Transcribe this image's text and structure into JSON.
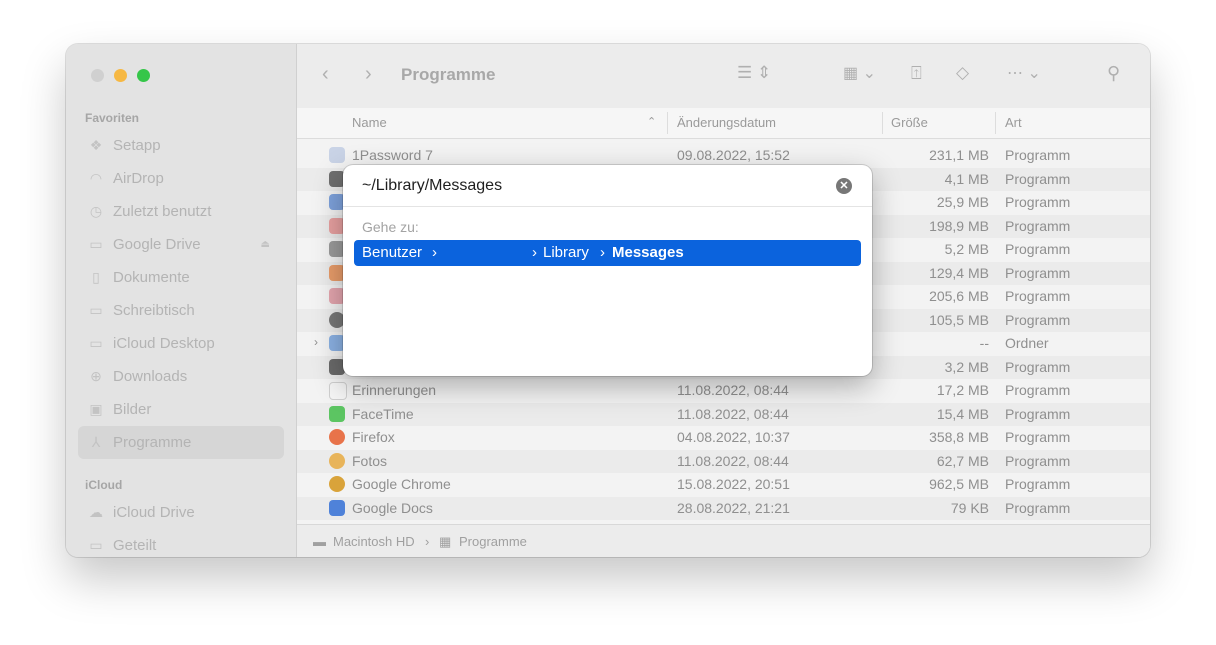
{
  "colors": {
    "accent": "#0b63dd",
    "minimize": "#f6b843",
    "maximize": "#35c649"
  },
  "sidebar": {
    "favorites_label": "Favoriten",
    "items": [
      {
        "label": "Setapp",
        "icon": "setapp-icon"
      },
      {
        "label": "AirDrop",
        "icon": "airdrop-icon"
      },
      {
        "label": "Zuletzt benutzt",
        "icon": "clock-icon"
      },
      {
        "label": "Google Drive",
        "icon": "drive-folder-icon"
      },
      {
        "label": "Dokumente",
        "icon": "document-icon"
      },
      {
        "label": "Schreibtisch",
        "icon": "desktop-icon"
      },
      {
        "label": "iCloud Desktop",
        "icon": "folder-icon"
      },
      {
        "label": "Downloads",
        "icon": "download-icon"
      },
      {
        "label": "Bilder",
        "icon": "photo-icon"
      },
      {
        "label": "Programme",
        "icon": "applications-icon",
        "active": true
      }
    ],
    "icloud_label": "iCloud",
    "icloud_items": [
      {
        "label": "iCloud Drive",
        "icon": "cloud-icon"
      },
      {
        "label": "Geteilt",
        "icon": "shared-folder-icon"
      }
    ]
  },
  "toolbar": {
    "title": "Programme"
  },
  "columns": {
    "name": "Name",
    "date": "Änderungsdatum",
    "size": "Größe",
    "kind": "Art"
  },
  "files": [
    {
      "name": "1Password 7",
      "date": "09.08.2022, 15:52",
      "size": "231,1 MB",
      "kind": "Programm"
    },
    {
      "name": "",
      "date": "",
      "size": "4,1 MB",
      "kind": "Programm"
    },
    {
      "name": "",
      "date": "",
      "size": "25,9 MB",
      "kind": "Programm"
    },
    {
      "name": "",
      "date": "",
      "size": "198,9 MB",
      "kind": "Programm"
    },
    {
      "name": "",
      "date": "",
      "size": "5,2 MB",
      "kind": "Programm"
    },
    {
      "name": "",
      "date": "",
      "size": "129,4 MB",
      "kind": "Programm"
    },
    {
      "name": "",
      "date": "",
      "size": "205,6 MB",
      "kind": "Programm"
    },
    {
      "name": "",
      "date": "",
      "size": "105,5 MB",
      "kind": "Programm"
    },
    {
      "name": "",
      "date": "",
      "size": "--",
      "kind": "Ordner"
    },
    {
      "name": "",
      "date": "",
      "size": "3,2 MB",
      "kind": "Programm"
    },
    {
      "name": "Erinnerungen",
      "date": "11.08.2022, 08:44",
      "size": "17,2 MB",
      "kind": "Programm"
    },
    {
      "name": "FaceTime",
      "date": "11.08.2022, 08:44",
      "size": "15,4 MB",
      "kind": "Programm"
    },
    {
      "name": "Firefox",
      "date": "04.08.2022, 10:37",
      "size": "358,8 MB",
      "kind": "Programm"
    },
    {
      "name": "Fotos",
      "date": "11.08.2022, 08:44",
      "size": "62,7 MB",
      "kind": "Programm"
    },
    {
      "name": "Google Chrome",
      "date": "15.08.2022, 20:51",
      "size": "962,5 MB",
      "kind": "Programm"
    },
    {
      "name": "Google Docs",
      "date": "28.08.2022, 21:21",
      "size": "79 KB",
      "kind": "Programm"
    }
  ],
  "pathbar": {
    "disk": "Macintosh HD",
    "sep": "›",
    "folder": "Programme"
  },
  "dialog": {
    "input_value": "~/Library/Messages",
    "goto_label": "Gehe zu:",
    "suggestion": {
      "part1": "Benutzer",
      "arrow1": "›",
      "arrow2": "›",
      "part2": "Library",
      "arrow3": "›",
      "part3": "Messages"
    }
  }
}
